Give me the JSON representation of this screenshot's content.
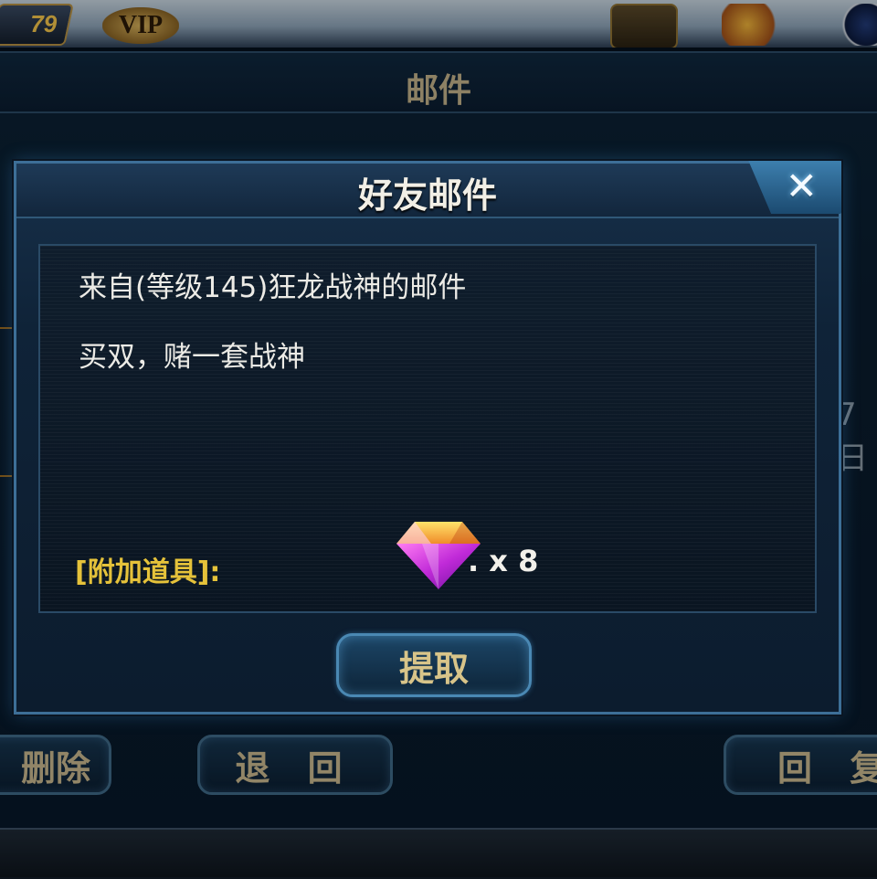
{
  "hud": {
    "level": "79",
    "vip_label": "VIP"
  },
  "mail_panel": {
    "title": "邮件",
    "right_partial_text": "7日"
  },
  "buttons": {
    "delete_label": "删除",
    "back_label": "退 回",
    "reply_label": "回 复"
  },
  "dialog": {
    "title": "好友邮件",
    "sender_line": "来自(等级145)狂龙战神的邮件",
    "body": "买双，赌一套战神",
    "attachment_label": "[附加道具]:",
    "attachment_item_icon": "purple-gem-icon",
    "attachment_quantity": ". x 8",
    "claim_label": "提取",
    "close_icon": "close-x-icon"
  },
  "colors": {
    "title_gold": "#c4b38b",
    "attachment_label": "#e5c23a",
    "frame_blue": "#3d6f97",
    "gem_purple": "#c02ad8"
  }
}
